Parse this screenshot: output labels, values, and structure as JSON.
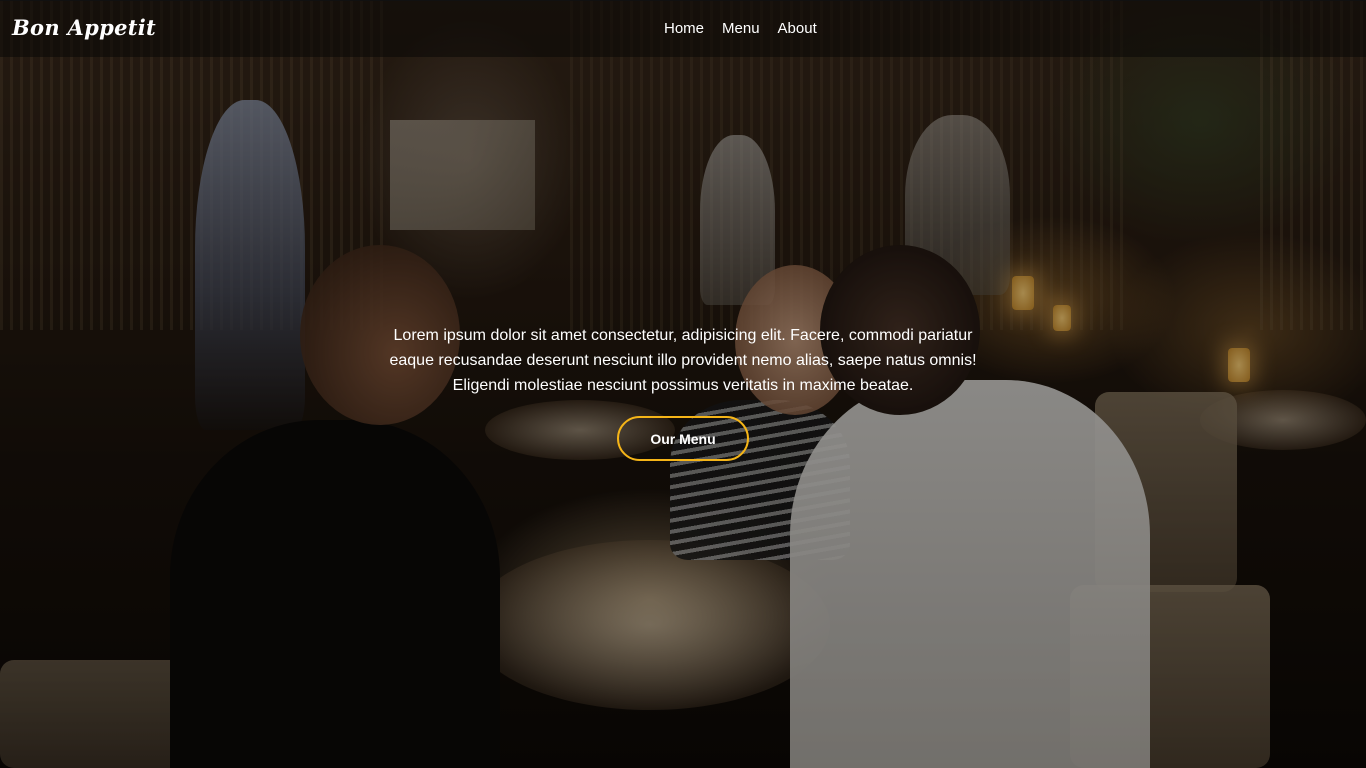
{
  "navbar": {
    "brand": "Bon Appetit",
    "links": [
      {
        "label": "Home"
      },
      {
        "label": "Menu"
      },
      {
        "label": "About"
      }
    ]
  },
  "hero": {
    "text": "Lorem ipsum dolor sit amet consectetur, adipisicing elit. Facere, commodi pariatur eaque recusandae deserunt nesciunt illo provident nemo alias, saepe natus omnis! Eligendi molestiae nesciunt possimus veritatis in maxime beatae.",
    "cta_label": "Our Menu",
    "background_image": "restaurant-dining-scene"
  },
  "colors": {
    "accent": "#f5b518",
    "text": "#ffffff"
  }
}
